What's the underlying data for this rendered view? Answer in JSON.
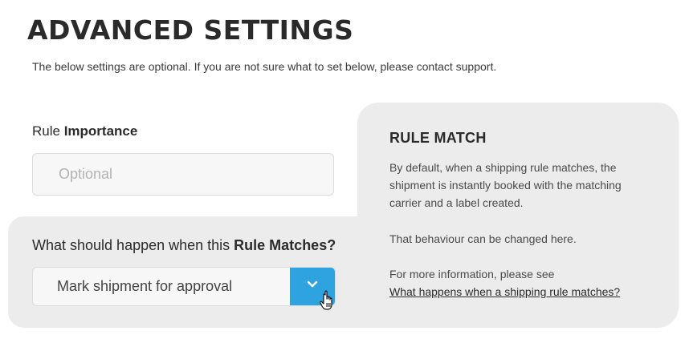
{
  "header": {
    "title": "ADVANCED SETTINGS",
    "subtitle": "The below settings are optional. If you are not sure what to set below, please contact support."
  },
  "importance": {
    "label_prefix": "Rule ",
    "label_bold": "Importance",
    "placeholder": "Optional",
    "value": ""
  },
  "match": {
    "question_prefix": "What should happen when this ",
    "question_bold": "Rule Matches?",
    "selected_option": "Mark shipment for approval",
    "dropdown_icon": "chevron-down-icon",
    "button_color": "#2fa3df"
  },
  "info": {
    "heading": "RULE MATCH",
    "paragraph1": "By default, when a shipping rule matches, the shipment is instantly booked with the matching carrier and a label created.",
    "paragraph2": "That behaviour can be changed here.",
    "paragraph3": "For more information, please see",
    "link_text": "What happens when a shipping rule matches?"
  }
}
